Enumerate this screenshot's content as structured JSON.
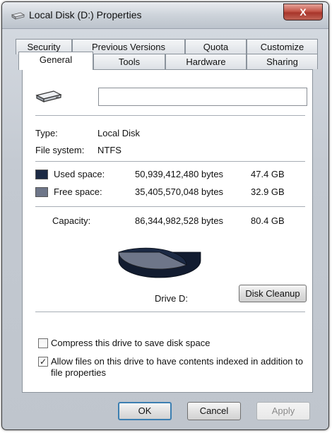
{
  "window": {
    "title": "Local Disk (D:) Properties",
    "close_label": "X"
  },
  "tabs": {
    "row1": [
      {
        "label": "Security"
      },
      {
        "label": "Previous Versions"
      },
      {
        "label": "Quota"
      },
      {
        "label": "Customize"
      }
    ],
    "row2": [
      {
        "label": "General",
        "active": true
      },
      {
        "label": "Tools"
      },
      {
        "label": "Hardware"
      },
      {
        "label": "Sharing"
      }
    ]
  },
  "general": {
    "name_value": "",
    "type_label": "Type:",
    "type_value": "Local Disk",
    "fs_label": "File system:",
    "fs_value": "NTFS",
    "used": {
      "label": "Used space:",
      "bytes": "50,939,412,480 bytes",
      "size": "47.4 GB",
      "color": "#1c2a44"
    },
    "free": {
      "label": "Free space:",
      "bytes": "35,405,570,048 bytes",
      "size": "32.9 GB",
      "color": "#6e7689"
    },
    "capacity": {
      "label": "Capacity:",
      "bytes": "86,344,982,528 bytes",
      "size": "80.4 GB"
    },
    "drive_label": "Drive D:",
    "cleanup_label": "Disk Cleanup",
    "compress_label": "Compress this drive to save disk space",
    "compress_checked": false,
    "index_label_line1": "Allow files on this drive to have contents indexed in addition to",
    "index_label_line2": "file properties",
    "index_checked": true
  },
  "buttons": {
    "ok": "OK",
    "cancel": "Cancel",
    "apply": "Apply"
  },
  "icons": {
    "title": "drive-icon",
    "drive": "hard-drive-icon"
  }
}
